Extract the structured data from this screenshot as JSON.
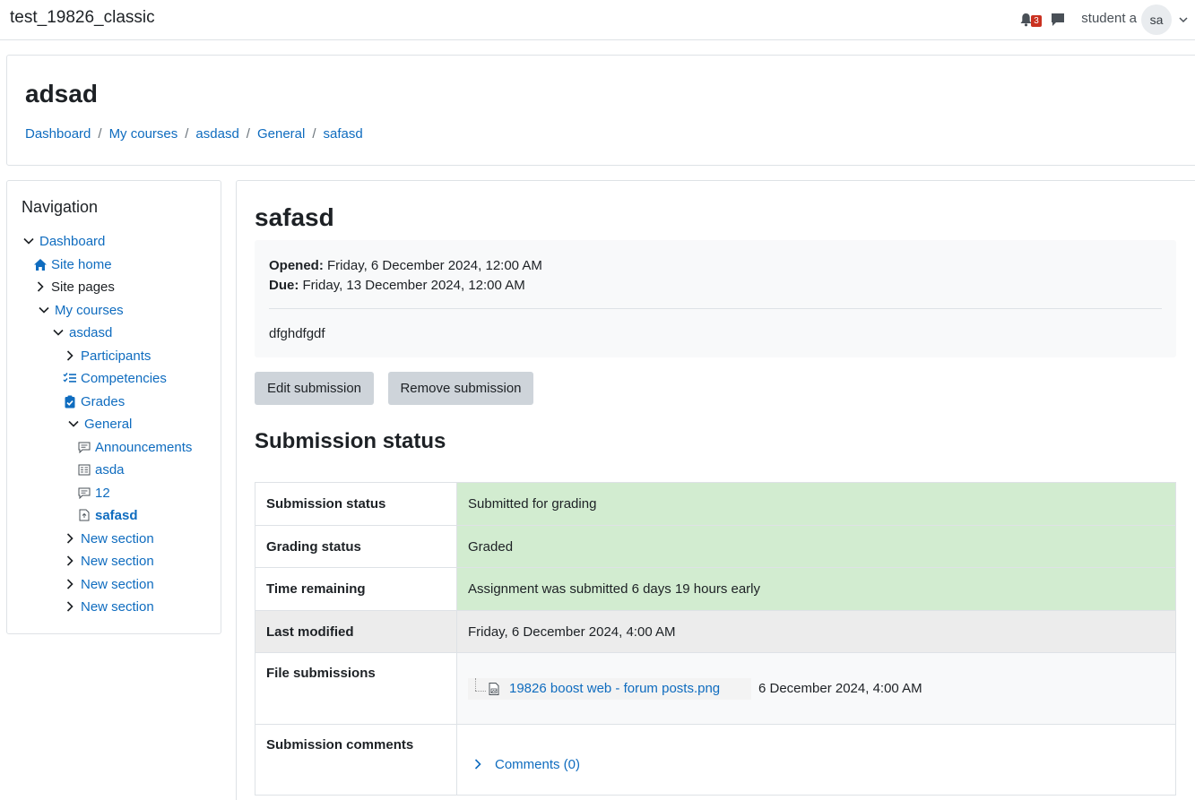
{
  "navbar": {
    "site_name": "test_19826_classic",
    "notification_count": "3",
    "username": "student a",
    "avatar_initials": "sa"
  },
  "header": {
    "title": "adsad",
    "breadcrumb": [
      "Dashboard",
      "My courses",
      "asdasd",
      "General",
      "safasd"
    ],
    "separator": "/"
  },
  "navigation": {
    "title": "Navigation",
    "items": [
      {
        "label": "Dashboard",
        "icon": "chevron-down-icon"
      },
      {
        "label": "Site home",
        "icon": "home-icon"
      },
      {
        "label": "Site pages",
        "icon": "chevron-right-icon"
      },
      {
        "label": "My courses",
        "icon": "chevron-down-icon"
      },
      {
        "label": "asdasd",
        "icon": "chevron-down-icon"
      },
      {
        "label": "Participants",
        "icon": "chevron-right-icon"
      },
      {
        "label": "Competencies",
        "icon": "checklist-icon"
      },
      {
        "label": "Grades",
        "icon": "clipboard-check-icon"
      },
      {
        "label": "General",
        "icon": "chevron-down-icon"
      },
      {
        "label": "Announcements",
        "icon": "forum-icon"
      },
      {
        "label": "asda",
        "icon": "glossary-icon"
      },
      {
        "label": "12",
        "icon": "forum-icon"
      },
      {
        "label": "safasd",
        "icon": "assignment-icon"
      },
      {
        "label": "New section",
        "icon": "chevron-right-icon"
      },
      {
        "label": "New section",
        "icon": "chevron-right-icon"
      },
      {
        "label": "New section",
        "icon": "chevron-right-icon"
      },
      {
        "label": "New section",
        "icon": "chevron-right-icon"
      }
    ]
  },
  "activity": {
    "title": "safasd",
    "opened_label": "Opened:",
    "opened_value": "Friday, 6 December 2024, 12:00 AM",
    "due_label": "Due:",
    "due_value": "Friday, 13 December 2024, 12:00 AM",
    "intro": "dfghdfgdf",
    "edit_button": "Edit submission",
    "remove_button": "Remove submission",
    "section_title": "Submission status"
  },
  "status_table": {
    "submission_status_label": "Submission status",
    "submission_status_value": "Submitted for grading",
    "grading_status_label": "Grading status",
    "grading_status_value": "Graded",
    "time_remaining_label": "Time remaining",
    "time_remaining_value": "Assignment was submitted 6 days 19 hours early",
    "last_modified_label": "Last modified",
    "last_modified_value": "Friday, 6 December 2024, 4:00 AM",
    "file_submissions_label": "File submissions",
    "file_name": "19826 boost web - forum posts.png",
    "file_date": "6 December 2024, 4:00 AM",
    "comments_label": "Submission comments",
    "comments_link": "Comments (0)"
  },
  "colors": {
    "link": "#0f6cbf",
    "success_bg": "#d2ecd0",
    "badge": "#ca3120",
    "button_bg": "#ced4da"
  }
}
